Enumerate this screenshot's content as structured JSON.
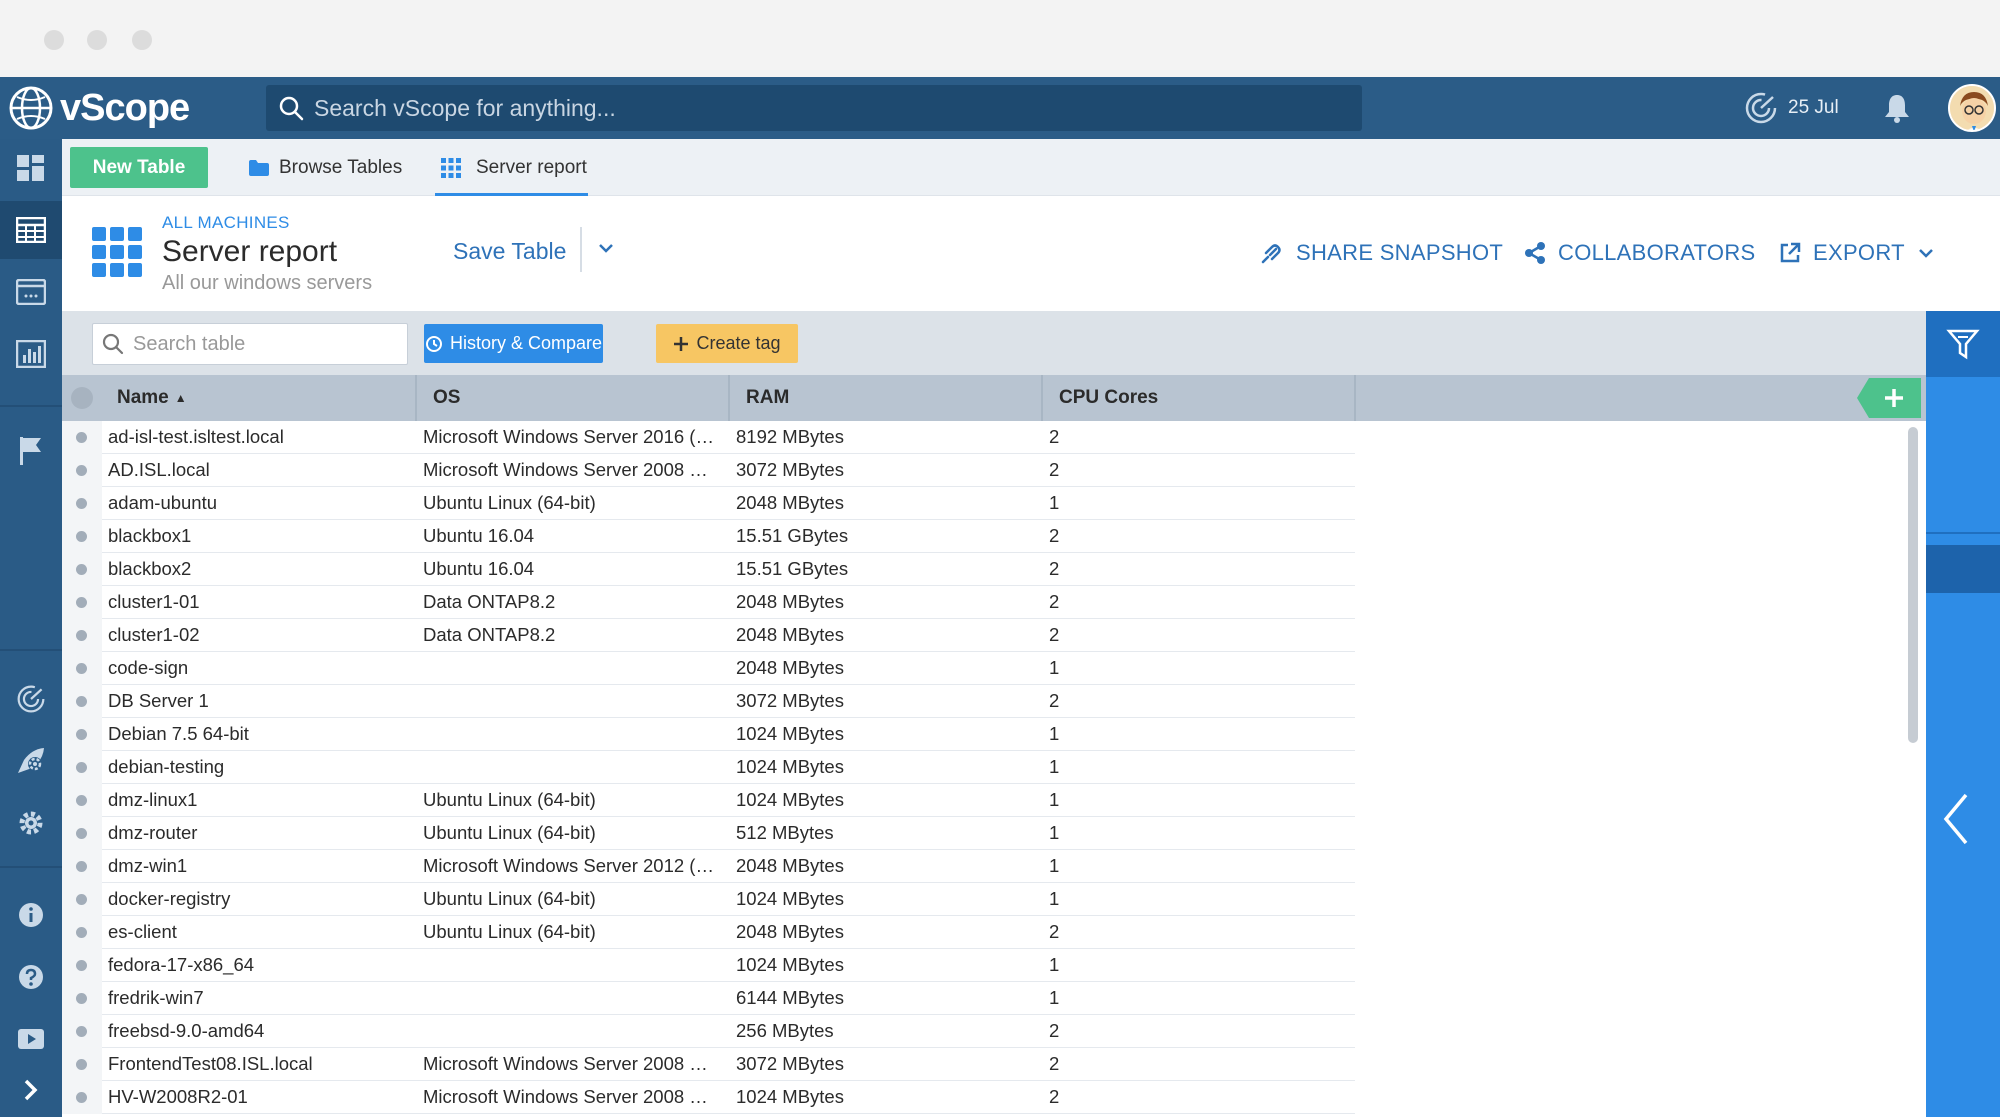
{
  "app": {
    "name": "vScope",
    "search_placeholder": "Search vScope for anything...",
    "date": "25 Jul"
  },
  "tabs": {
    "new_table_label": "New Table",
    "browse_label": "Browse Tables",
    "server_label": "Server report"
  },
  "header": {
    "breadcrumb": "ALL MACHINES",
    "title": "Server report",
    "subtitle": "All our windows servers",
    "save_label": "Save Table",
    "share_label": "SHARE SNAPSHOT",
    "collab_label": "COLLABORATORS",
    "export_label": "EXPORT"
  },
  "toolbar": {
    "search_placeholder": "Search table",
    "history_label": "History & Compare",
    "tag_label": "Create tag"
  },
  "table": {
    "columns": [
      "Name",
      "OS",
      "RAM",
      "CPU Cores"
    ],
    "sort_indicator": "▲",
    "rows": [
      {
        "name": "ad-isl-test.isltest.local",
        "os": "Microsoft Windows Server 2016 (…",
        "ram": "8192 MBytes",
        "cpu": "2"
      },
      {
        "name": "AD.ISL.local",
        "os": "Microsoft Windows Server 2008 …",
        "ram": "3072 MBytes",
        "cpu": "2"
      },
      {
        "name": "adam-ubuntu",
        "os": "Ubuntu Linux (64-bit)",
        "ram": "2048 MBytes",
        "cpu": "1"
      },
      {
        "name": "blackbox1",
        "os": "Ubuntu 16.04",
        "ram": "15.51 GBytes",
        "cpu": "2"
      },
      {
        "name": "blackbox2",
        "os": "Ubuntu 16.04",
        "ram": "15.51 GBytes",
        "cpu": "2"
      },
      {
        "name": "cluster1-01",
        "os": "Data ONTAP8.2",
        "ram": "2048 MBytes",
        "cpu": "2"
      },
      {
        "name": "cluster1-02",
        "os": "Data ONTAP8.2",
        "ram": "2048 MBytes",
        "cpu": "2"
      },
      {
        "name": "code-sign",
        "os": "",
        "ram": "2048 MBytes",
        "cpu": "1"
      },
      {
        "name": "DB Server 1",
        "os": "",
        "ram": "3072 MBytes",
        "cpu": "2"
      },
      {
        "name": "Debian 7.5 64-bit",
        "os": "",
        "ram": "1024 MBytes",
        "cpu": "1"
      },
      {
        "name": "debian-testing",
        "os": "",
        "ram": "1024 MBytes",
        "cpu": "1"
      },
      {
        "name": "dmz-linux1",
        "os": "Ubuntu Linux (64-bit)",
        "ram": "1024 MBytes",
        "cpu": "1"
      },
      {
        "name": "dmz-router",
        "os": "Ubuntu Linux (64-bit)",
        "ram": "512 MBytes",
        "cpu": "1"
      },
      {
        "name": "dmz-win1",
        "os": "Microsoft Windows Server 2012 (…",
        "ram": "2048 MBytes",
        "cpu": "1"
      },
      {
        "name": "docker-registry",
        "os": "Ubuntu Linux (64-bit)",
        "ram": "1024 MBytes",
        "cpu": "1"
      },
      {
        "name": "es-client",
        "os": "Ubuntu Linux (64-bit)",
        "ram": "2048 MBytes",
        "cpu": "2"
      },
      {
        "name": "fedora-17-x86_64",
        "os": "",
        "ram": "1024 MBytes",
        "cpu": "1"
      },
      {
        "name": "fredrik-win7",
        "os": "",
        "ram": "6144 MBytes",
        "cpu": "1"
      },
      {
        "name": "freebsd-9.0-amd64",
        "os": "",
        "ram": "256 MBytes",
        "cpu": "2"
      },
      {
        "name": "FrontendTest08.ISL.local",
        "os": "Microsoft Windows Server 2008 …",
        "ram": "3072 MBytes",
        "cpu": "2"
      },
      {
        "name": "HV-W2008R2-01",
        "os": "Microsoft Windows Server 2008 …",
        "ram": "1024 MBytes",
        "cpu": "2"
      }
    ]
  },
  "colors": {
    "topbar": "#2b5c87",
    "accent_blue": "#2e8ce6",
    "green": "#4dc28c",
    "yellow": "#f7c663"
  }
}
